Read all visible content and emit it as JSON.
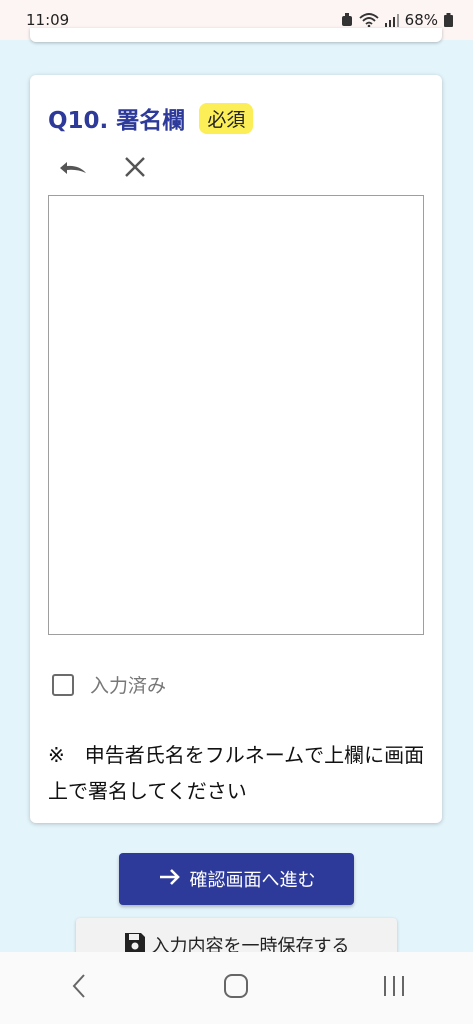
{
  "status_bar": {
    "time": "11:09",
    "battery": "68%",
    "icons": [
      "alarm-icon",
      "wifi-icon",
      "signal-icon",
      "battery-icon"
    ]
  },
  "question": {
    "label": "Q10. 署名欄",
    "required_badge": "必須",
    "toolbar": {
      "undo_icon": "undo-icon",
      "clear_icon": "close-icon"
    },
    "checkbox_label": "入力済み",
    "note": "※　申告者氏名をフルネームで上欄に画面上で署名してください"
  },
  "actions": {
    "confirm_label": "確認画面へ進む",
    "save_label": "入力内容を一時保存する"
  },
  "colors": {
    "accent": "#2d3a9a",
    "badge": "#fbee57",
    "background": "#e3f4fb"
  }
}
